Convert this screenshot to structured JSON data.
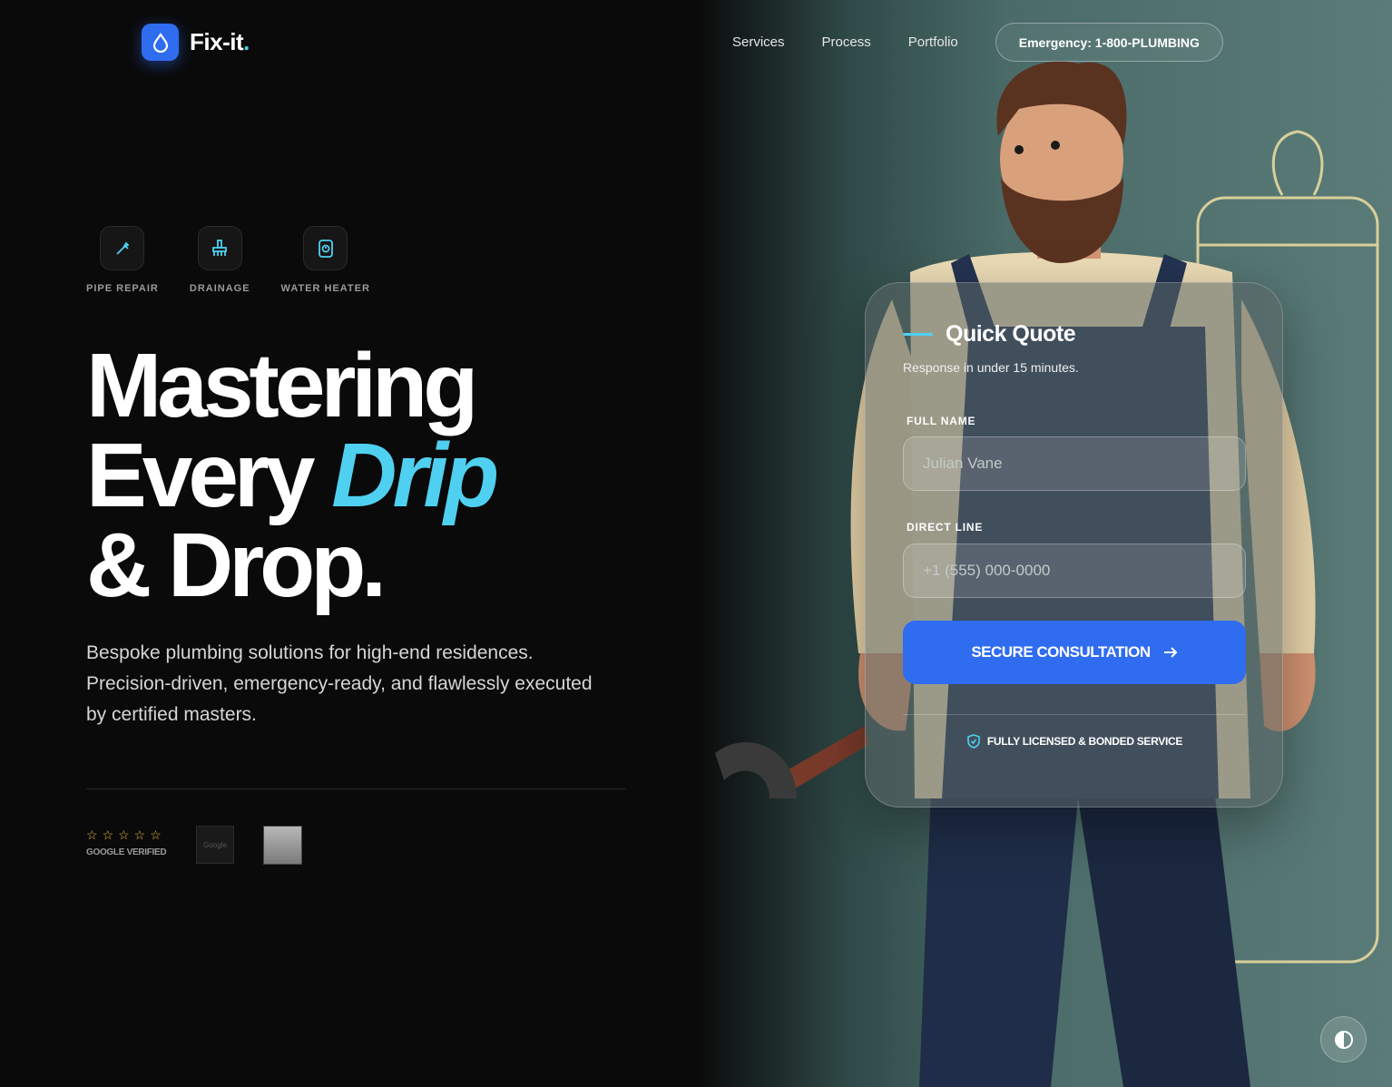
{
  "brand": {
    "name": "Fix-it",
    "dot": ".",
    "logo_icon": "water-drop-icon",
    "accent": "#2f6cf0",
    "highlight": "#4fd0f0"
  },
  "nav": {
    "links": [
      "Services",
      "Process",
      "Portfolio"
    ],
    "emergency": "Emergency: 1-800-PLUMBING"
  },
  "services": [
    {
      "label": "PIPE REPAIR",
      "icon": "wrench-icon"
    },
    {
      "label": "DRAINAGE",
      "icon": "brush-icon"
    },
    {
      "label": "WATER HEATER",
      "icon": "water-heater-icon"
    }
  ],
  "hero": {
    "line1": "Mastering",
    "line2a": "Every",
    "line2b": "Drip",
    "line3": "& Drop."
  },
  "description": "Bespoke plumbing solutions for high-end residences. Precision-driven, emergency-ready, and flawlessly executed by certified masters.",
  "rating": {
    "stars": "☆☆☆☆☆",
    "label": "GOOGLE VERIFIED",
    "thumb1": "Google"
  },
  "quote": {
    "title": "Quick Quote",
    "subtitle": "Response in under 15 minutes.",
    "name_label": "FULL NAME",
    "name_placeholder": "Julian Vane",
    "phone_label": "DIRECT LINE",
    "phone_placeholder": "+1 (555) 000-0000",
    "button": "SECURE CONSULTATION",
    "button_icon": "arrow-right-icon",
    "license": "FULLY LICENSED & BONDED SERVICE",
    "license_icon": "shield-check-icon"
  },
  "theme_toggle_icon": "contrast-icon"
}
